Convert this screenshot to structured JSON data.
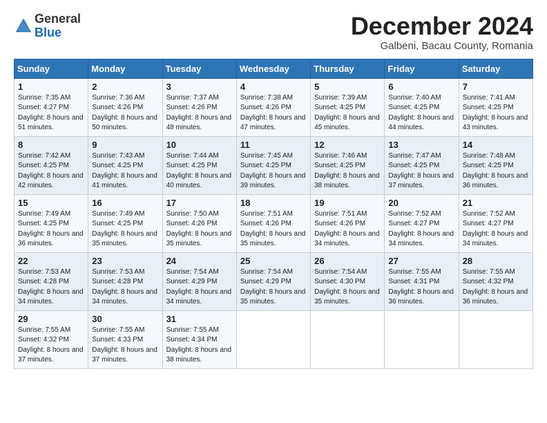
{
  "logo": {
    "general": "General",
    "blue": "Blue"
  },
  "title": "December 2024",
  "location": "Galbeni, Bacau County, Romania",
  "days_of_week": [
    "Sunday",
    "Monday",
    "Tuesday",
    "Wednesday",
    "Thursday",
    "Friday",
    "Saturday"
  ],
  "weeks": [
    [
      {
        "day": "1",
        "sunrise": "7:35 AM",
        "sunset": "4:27 PM",
        "daylight": "8 hours and 51 minutes."
      },
      {
        "day": "2",
        "sunrise": "7:36 AM",
        "sunset": "4:26 PM",
        "daylight": "8 hours and 50 minutes."
      },
      {
        "day": "3",
        "sunrise": "7:37 AM",
        "sunset": "4:26 PM",
        "daylight": "8 hours and 48 minutes."
      },
      {
        "day": "4",
        "sunrise": "7:38 AM",
        "sunset": "4:26 PM",
        "daylight": "8 hours and 47 minutes."
      },
      {
        "day": "5",
        "sunrise": "7:39 AM",
        "sunset": "4:25 PM",
        "daylight": "8 hours and 45 minutes."
      },
      {
        "day": "6",
        "sunrise": "7:40 AM",
        "sunset": "4:25 PM",
        "daylight": "8 hours and 44 minutes."
      },
      {
        "day": "7",
        "sunrise": "7:41 AM",
        "sunset": "4:25 PM",
        "daylight": "8 hours and 43 minutes."
      }
    ],
    [
      {
        "day": "8",
        "sunrise": "7:42 AM",
        "sunset": "4:25 PM",
        "daylight": "8 hours and 42 minutes."
      },
      {
        "day": "9",
        "sunrise": "7:43 AM",
        "sunset": "4:25 PM",
        "daylight": "8 hours and 41 minutes."
      },
      {
        "day": "10",
        "sunrise": "7:44 AM",
        "sunset": "4:25 PM",
        "daylight": "8 hours and 40 minutes."
      },
      {
        "day": "11",
        "sunrise": "7:45 AM",
        "sunset": "4:25 PM",
        "daylight": "8 hours and 39 minutes."
      },
      {
        "day": "12",
        "sunrise": "7:46 AM",
        "sunset": "4:25 PM",
        "daylight": "8 hours and 38 minutes."
      },
      {
        "day": "13",
        "sunrise": "7:47 AM",
        "sunset": "4:25 PM",
        "daylight": "8 hours and 37 minutes."
      },
      {
        "day": "14",
        "sunrise": "7:48 AM",
        "sunset": "4:25 PM",
        "daylight": "8 hours and 36 minutes."
      }
    ],
    [
      {
        "day": "15",
        "sunrise": "7:49 AM",
        "sunset": "4:25 PM",
        "daylight": "8 hours and 36 minutes."
      },
      {
        "day": "16",
        "sunrise": "7:49 AM",
        "sunset": "4:25 PM",
        "daylight": "8 hours and 35 minutes."
      },
      {
        "day": "17",
        "sunrise": "7:50 AM",
        "sunset": "4:26 PM",
        "daylight": "8 hours and 35 minutes."
      },
      {
        "day": "18",
        "sunrise": "7:51 AM",
        "sunset": "4:26 PM",
        "daylight": "8 hours and 35 minutes."
      },
      {
        "day": "19",
        "sunrise": "7:51 AM",
        "sunset": "4:26 PM",
        "daylight": "8 hours and 34 minutes."
      },
      {
        "day": "20",
        "sunrise": "7:52 AM",
        "sunset": "4:27 PM",
        "daylight": "8 hours and 34 minutes."
      },
      {
        "day": "21",
        "sunrise": "7:52 AM",
        "sunset": "4:27 PM",
        "daylight": "8 hours and 34 minutes."
      }
    ],
    [
      {
        "day": "22",
        "sunrise": "7:53 AM",
        "sunset": "4:28 PM",
        "daylight": "8 hours and 34 minutes."
      },
      {
        "day": "23",
        "sunrise": "7:53 AM",
        "sunset": "4:28 PM",
        "daylight": "8 hours and 34 minutes."
      },
      {
        "day": "24",
        "sunrise": "7:54 AM",
        "sunset": "4:29 PM",
        "daylight": "8 hours and 34 minutes."
      },
      {
        "day": "25",
        "sunrise": "7:54 AM",
        "sunset": "4:29 PM",
        "daylight": "8 hours and 35 minutes."
      },
      {
        "day": "26",
        "sunrise": "7:54 AM",
        "sunset": "4:30 PM",
        "daylight": "8 hours and 35 minutes."
      },
      {
        "day": "27",
        "sunrise": "7:55 AM",
        "sunset": "4:31 PM",
        "daylight": "8 hours and 36 minutes."
      },
      {
        "day": "28",
        "sunrise": "7:55 AM",
        "sunset": "4:32 PM",
        "daylight": "8 hours and 36 minutes."
      }
    ],
    [
      {
        "day": "29",
        "sunrise": "7:55 AM",
        "sunset": "4:32 PM",
        "daylight": "8 hours and 37 minutes."
      },
      {
        "day": "30",
        "sunrise": "7:55 AM",
        "sunset": "4:33 PM",
        "daylight": "8 hours and 37 minutes."
      },
      {
        "day": "31",
        "sunrise": "7:55 AM",
        "sunset": "4:34 PM",
        "daylight": "8 hours and 38 minutes."
      },
      null,
      null,
      null,
      null
    ]
  ],
  "labels": {
    "sunrise": "Sunrise:",
    "sunset": "Sunset:",
    "daylight": "Daylight:"
  }
}
